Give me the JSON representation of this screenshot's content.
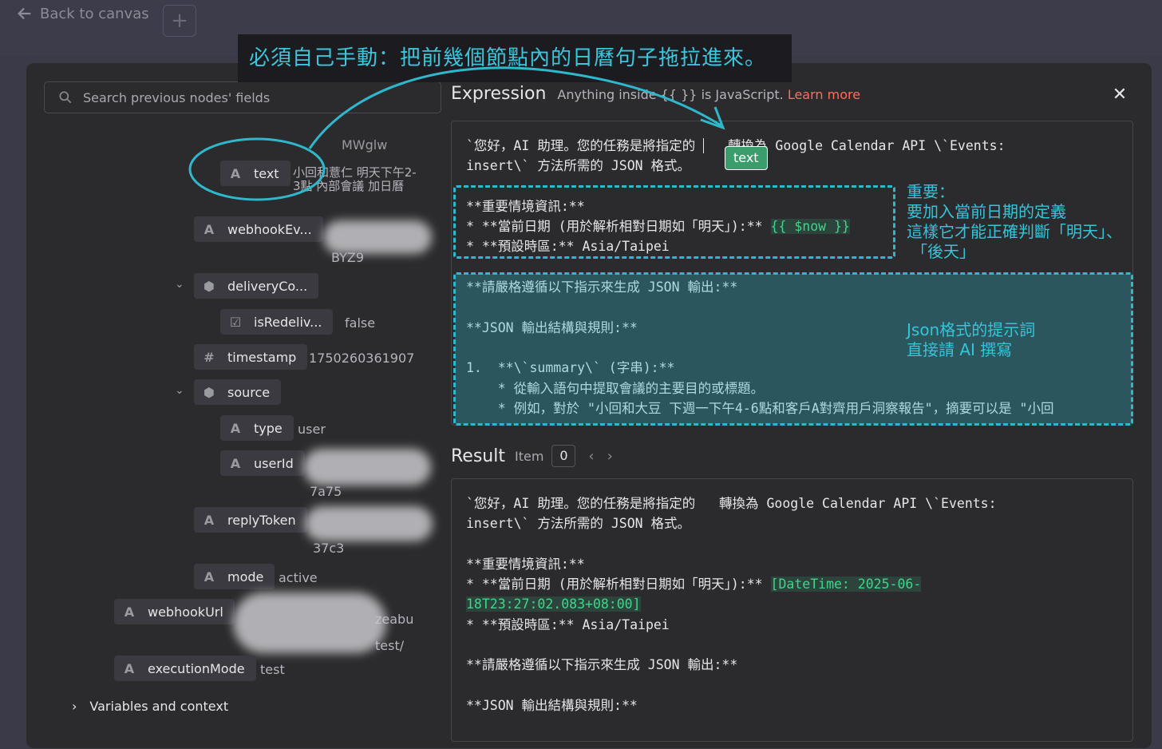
{
  "top": {
    "back_label": "Back to canvas",
    "plus": "+"
  },
  "search": {
    "placeholder": "Search previous nodes' fields"
  },
  "fields": [
    {
      "label": "text",
      "value": "小回和薏仁 明天下午2-3點 內部會議 加日曆"
    },
    {
      "label": "webhookEv...",
      "value": "BYZ9"
    },
    {
      "label": "deliveryCo...",
      "value": ""
    },
    {
      "label": "isRedeliv...",
      "value": "false"
    },
    {
      "label": "timestamp",
      "value": "1750260361907"
    },
    {
      "label": "source",
      "value": ""
    },
    {
      "label": "type",
      "value": "user"
    },
    {
      "label": "userId",
      "value": "7a75"
    },
    {
      "label": "replyToken",
      "value": "37c3"
    },
    {
      "label": "mode",
      "value": "active"
    },
    {
      "label": "webhookUrl",
      "value": "zeabu test/"
    },
    {
      "label": "executionMode",
      "value": "test"
    }
  ],
  "text_top_partial": "MWglw",
  "variables_label": "Variables and context",
  "expression": {
    "title": "Expression",
    "subtitle_pre": "Anything inside {{ }} is JavaScript.",
    "learn_more": "Learn more",
    "lines": [
      "`您好，AI 助理。您的任務是將指定的 ",
      "insert\\` 方法所需的 JSON 格式。",
      "",
      "**重要情境資訊:**",
      "* **當前日期 (用於解析相對日期如「明天」):** ",
      "* **預設時區:** Asia/Taipei",
      "",
      "**請嚴格遵循以下指示來生成 JSON 輸出:**",
      "",
      "**JSON 輸出結構與規則:**",
      "",
      "1.  **\\`summary\\` (字串):**",
      "    * 從輸入語句中提取會議的主要目的或標題。",
      "    * 例如，對於 \"小回和大豆 下週一下午4-6點和客戶A對齊用戶洞察報告\"，摘要可以是 \"小回"
    ],
    "line1_rest": "轉換為 Google Calendar API \\`Events:",
    "now_expr": "{{ $now }}",
    "tooltip": "text"
  },
  "result": {
    "title": "Result",
    "item_label": "Item",
    "item_num": "0",
    "line1": "`您好，AI 助理。您的任務是將指定的   轉換為 Google Calendar API \\`Events:",
    "line2": "insert\\` 方法所需的 JSON 格式。",
    "line4": "**重要情境資訊:**",
    "line5": "* **當前日期 (用於解析相對日期如「明天」):** ",
    "date1": "[DateTime: 2025-06-",
    "date2": "18T23:27:02.083+08:00]",
    "line7": "* **預設時區:** Asia/Taipei",
    "line9": "**請嚴格遵循以下指示來生成 JSON 輸出:**",
    "line11": "**JSON 輸出結構與規則:**"
  },
  "annotations": {
    "banner": "必須自己手動：把前幾個節點內的日曆句子拖拉進來。",
    "important": [
      "重要：",
      "要加入當前日期的定義",
      "這樣它才能正確判斷「明天」、",
      "「後天」"
    ],
    "json_note": [
      "Json格式的提示詞",
      "直接請 AI 撰寫"
    ]
  },
  "colors": {
    "accent": "#ff6d5a",
    "annotation": "#2fb8cc",
    "expr_green": "#3fd68a"
  }
}
